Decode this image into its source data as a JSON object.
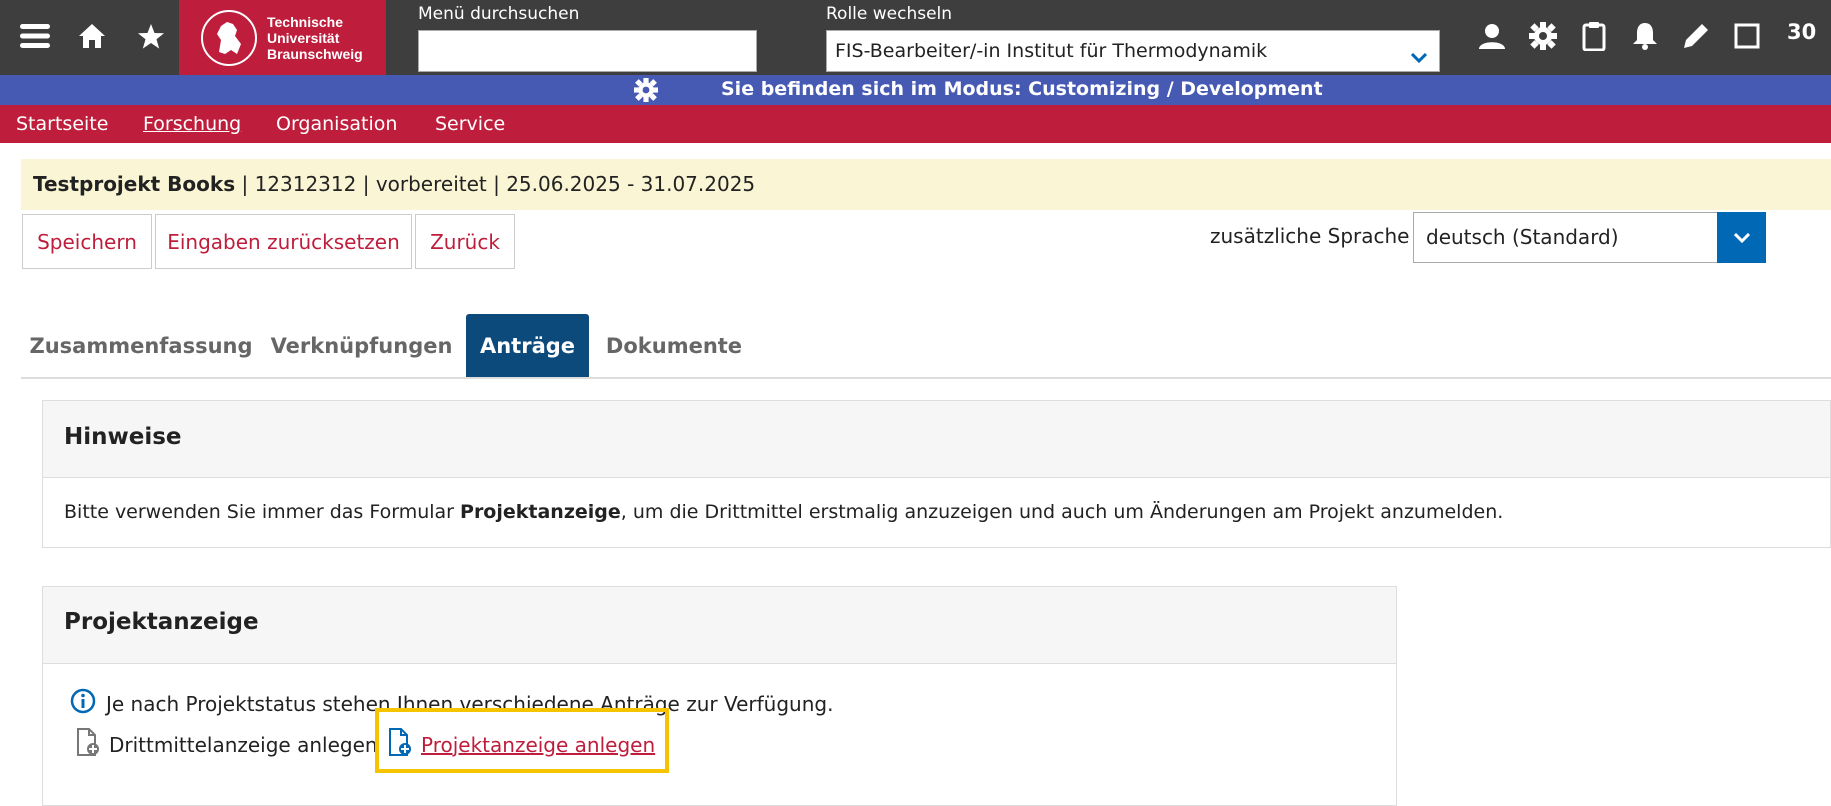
{
  "topbar": {
    "icons": [
      "menu-icon",
      "home-icon",
      "star-icon"
    ],
    "logo": {
      "line1": "Technische",
      "line2": "Universität",
      "line3": "Braunschweig"
    },
    "menu_search": {
      "label": "Menü durchsuchen",
      "value": "",
      "placeholder": ""
    },
    "role": {
      "label": "Rolle wechseln",
      "value": "FIS-Bearbeiter/-in Institut für Thermodynamik"
    },
    "right_icons": [
      "user-icon",
      "gear-icon",
      "clipboard-icon",
      "bell-icon",
      "pencil-icon",
      "window-icon"
    ],
    "counter": "30"
  },
  "mode_banner": {
    "icon": "gear-icon",
    "text": "Sie befinden sich im Modus: Customizing / Development"
  },
  "nav": {
    "items": [
      "Startseite",
      "Forschung",
      "Organisation",
      "Service"
    ],
    "active": "Forschung"
  },
  "project": {
    "name": "Testprojekt Books",
    "rest": " | 12312312 | vorbereitet | 25.06.2025 - 31.07.2025"
  },
  "actions": {
    "save": "Speichern",
    "reset": "Eingaben zurücksetzen",
    "back": "Zurück"
  },
  "language": {
    "label": "zusätzliche Sprache",
    "value": "deutsch (Standard)"
  },
  "tabs": [
    "Zusammenfassung",
    "Verknüpfungen",
    "Anträge",
    "Dokumente"
  ],
  "active_tab": "Anträge",
  "hints": {
    "title": "Hinweise",
    "text_before": "Bitte verwenden Sie immer das Formular ",
    "text_bold": "Projektanzeige",
    "text_after": ", um die Drittmittel erstmalig anzuzeigen und auch um Änderungen am Projekt anzumelden."
  },
  "projektanzeige": {
    "title": "Projektanzeige",
    "info": "Je nach Projektstatus stehen Ihnen verschiedene Anträge zur Verfügung.",
    "link_drittmittel": "Drittmittelanzeige anlegen",
    "link_projektanzeige": "Projektanzeige anlegen"
  },
  "colors": {
    "brand_red": "#be1e3c",
    "mode_blue": "#4659b3",
    "tab_active": "#0d4a7c",
    "highlight": "#f5c300"
  }
}
